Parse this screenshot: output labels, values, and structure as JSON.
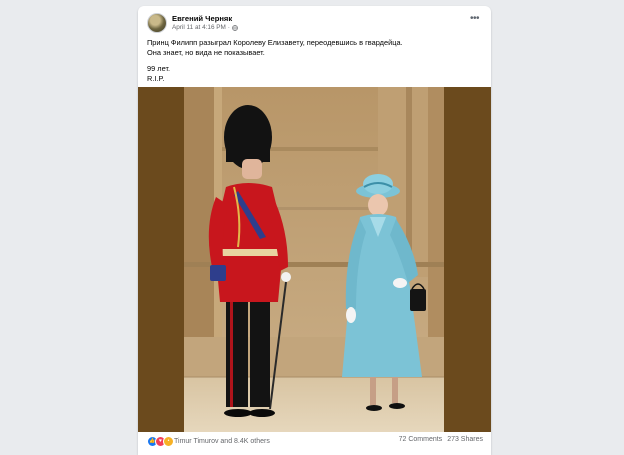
{
  "post": {
    "author": "Евгений Черняк",
    "timestamp": "April 11 at 4:16 PM",
    "separator": "·",
    "lines": [
      "Принц Филипп разыграл Королеву Елизавету, переодевшись в гвардейца.",
      "Она знает, но вида не показывает.",
      "99 лет.",
      "R.I.P."
    ]
  },
  "footer": {
    "reactions_text": "Timur Timurov and 8.4K others",
    "comments": "72 Comments",
    "shares": "273 Shares"
  },
  "colors": {
    "photo_border": "#6b4a1d",
    "guard_tunic": "#c8161d",
    "coat": "#7cc3d6",
    "fb_blue": "#1877f2"
  }
}
